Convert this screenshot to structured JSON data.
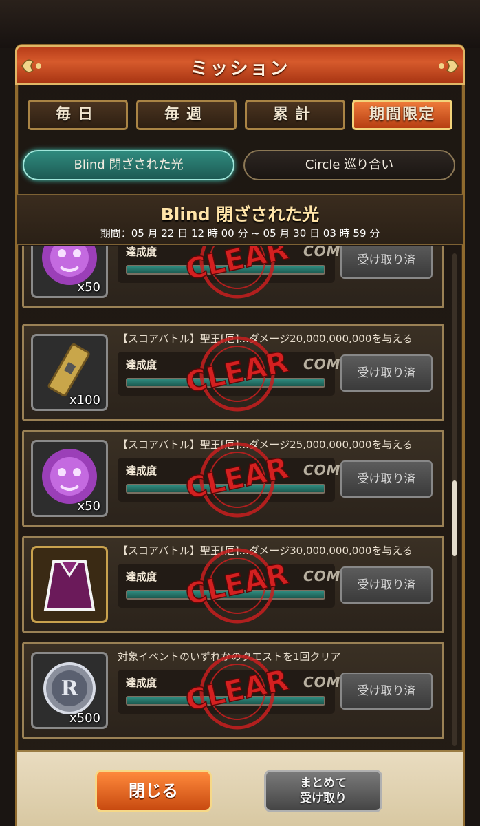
{
  "window": {
    "title": "ミッション"
  },
  "tabs": [
    {
      "label": "毎日",
      "active": false
    },
    {
      "label": "毎週",
      "active": false
    },
    {
      "label": "累計",
      "active": false
    },
    {
      "label": "期間限定",
      "active": true
    }
  ],
  "event_tabs": [
    {
      "label": "Blind 閉ざされた光",
      "active": true
    },
    {
      "label": "Circle 巡り合い",
      "active": false
    }
  ],
  "event": {
    "title": "Blind 閉ざされた光",
    "period": "期間：05 月 22 日 12 時 00 分 ~ 05 月 30 日 03 時 59 分"
  },
  "missions": [
    {
      "text": "",
      "progress_label": "達成度",
      "progress": 1.0,
      "status": "COMPLETE",
      "stamp": "CLEAR",
      "button": "受け取り済",
      "reward_icon": "purple-spirit-icon",
      "quantity": "x50"
    },
    {
      "text": "【スコアバトル】聖王[厄]...ダメージ20,000,000,000を与える",
      "progress_label": "達成度",
      "progress": 1.0,
      "status": "COMPLETE",
      "stamp": "CLEAR",
      "button": "受け取り済",
      "reward_icon": "gold-ticket-icon",
      "quantity": "x100"
    },
    {
      "text": "【スコアバトル】聖王[厄]...ダメージ25,000,000,000を与える",
      "progress_label": "達成度",
      "progress": 1.0,
      "status": "COMPLETE",
      "stamp": "CLEAR",
      "button": "受け取り済",
      "reward_icon": "purple-spirit-icon",
      "quantity": "x50"
    },
    {
      "text": "【スコアバトル】聖王[厄]...ダメージ30,000,000,000を与える",
      "progress_label": "達成度",
      "progress": 1.0,
      "status": "COMPLETE",
      "stamp": "CLEAR",
      "button": "受け取り済",
      "reward_icon": "cape-costume-icon",
      "quantity": ""
    },
    {
      "text": "対象イベントのいずれかのクエストを1回クリア",
      "progress_label": "達成度",
      "progress": 1.0,
      "status": "COMPLETE",
      "stamp": "CLEAR",
      "button": "受け取り済",
      "reward_icon": "silver-coin-icon",
      "quantity": "x500"
    }
  ],
  "footer": {
    "close_label": "閉じる",
    "claim_all_line1": "まとめて",
    "claim_all_line2": "受け取り"
  },
  "colors": {
    "title_bar": "#c44a1e",
    "active_tab": "#e06a2c",
    "active_subtab": "#2f8a7e",
    "stamp_red": "#c81e1e",
    "progress_fill": "#2f8a7e"
  }
}
